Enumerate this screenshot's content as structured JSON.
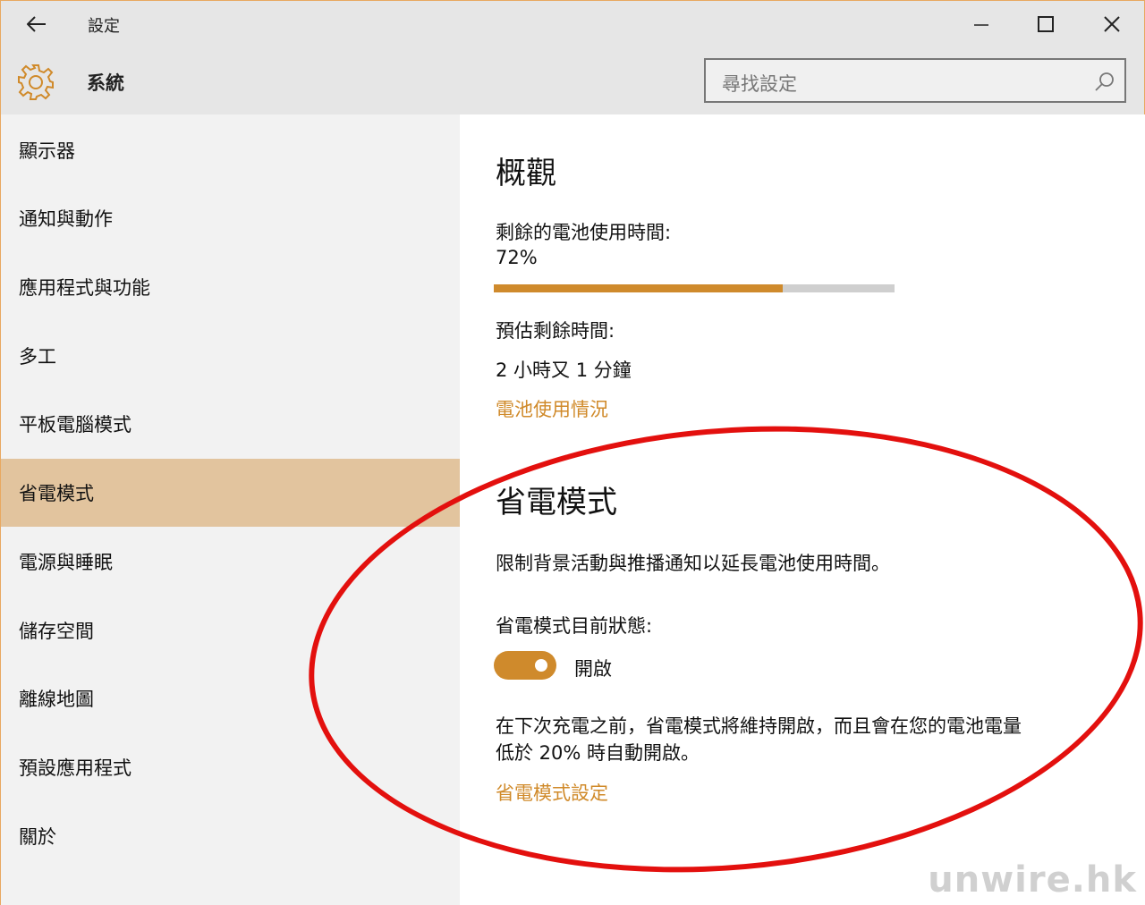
{
  "window": {
    "title": "設定"
  },
  "header": {
    "section_title": "系統",
    "search_placeholder": "尋找設定"
  },
  "sidebar": {
    "items": [
      {
        "label": "顯示器"
      },
      {
        "label": "通知與動作"
      },
      {
        "label": "應用程式與功能"
      },
      {
        "label": "多工"
      },
      {
        "label": "平板電腦模式"
      },
      {
        "label": "省電模式",
        "selected": true
      },
      {
        "label": "電源與睡眠"
      },
      {
        "label": "儲存空間"
      },
      {
        "label": "離線地圖"
      },
      {
        "label": "預設應用程式"
      },
      {
        "label": "關於"
      }
    ]
  },
  "overview": {
    "heading": "概觀",
    "battery_label": "剩餘的電池使用時間:",
    "battery_percent_text": "72%",
    "battery_fraction": 0.72,
    "estimate_label": "預估剩餘時間:",
    "estimate_value": "2 小時又 1 分鐘",
    "usage_link": "電池使用情況"
  },
  "saver": {
    "heading": "省電模式",
    "description": "限制背景活動與推播通知以延長電池使用時間。",
    "status_label": "省電模式目前狀態:",
    "toggle_on": true,
    "toggle_text": "開啟",
    "note_line1": "在下次充電之前，省電模式將維持開啟，而且會在您的電池電量",
    "note_line2": "低於 20% 時自動開啟。",
    "settings_link": "省電模式設定"
  },
  "watermark": "unwire.hk",
  "colors": {
    "accent": "#cf8a2c",
    "selected_nav": "#e2c49e",
    "annotation_ellipse": "#e3100e"
  }
}
